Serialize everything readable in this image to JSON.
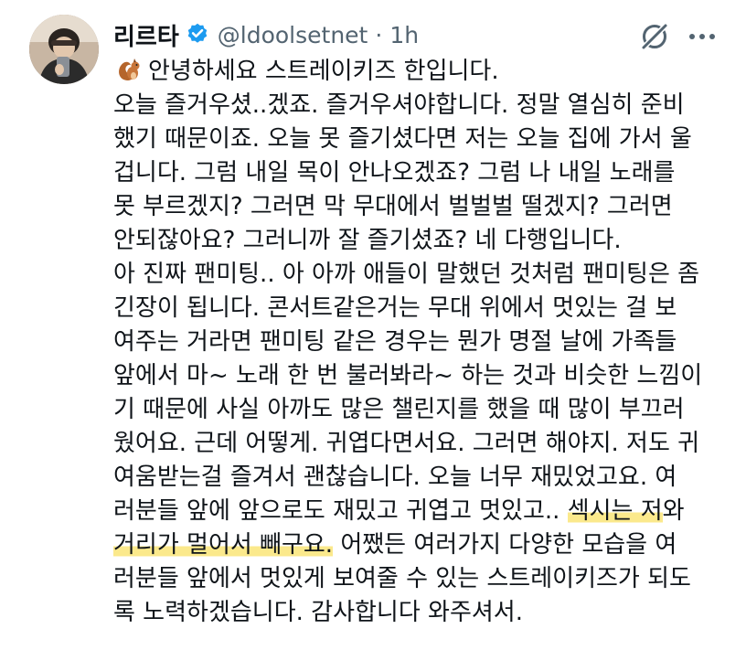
{
  "author": {
    "display_name": "리르타",
    "handle": "@ldoolsetnet",
    "separator": "·",
    "timestamp": "1h"
  },
  "icons": {
    "verified": "verified-badge-icon",
    "grok": "grok-icon",
    "more": "more-options-icon",
    "squirrel": "squirrel-emoji"
  },
  "colors": {
    "verified": "#1d9bf0",
    "highlight": "#fbe98c",
    "secondary_text": "#536471"
  },
  "tweet": {
    "lines": [
      [
        {
          "t": "안녕하세요 스트레이키즈 한입니다."
        }
      ],
      [
        {
          "t": "오늘 즐거우셨..겠죠. 즐거우셔야합니다. 정말 열심히 준비"
        }
      ],
      [
        {
          "t": "했기 때문이죠. 오늘 못 즐기셨다면 저는 오늘 집에 가서 울"
        }
      ],
      [
        {
          "t": "겁니다. 그럼 내일 목이 안나오겠죠? 그럼 나 내일 노래를"
        }
      ],
      [
        {
          "t": "못 부르겠지? 그러면 막 무대에서 벌벌벌 떨겠지? 그러면"
        }
      ],
      [
        {
          "t": "안되잖아요? 그러니까 잘 즐기셨죠? 네 다행입니다."
        }
      ],
      [
        {
          "t": "아 진짜 팬미팅.. 아 아까 애들이 말했던 것처럼 팬미팅은 좀"
        }
      ],
      [
        {
          "t": "긴장이 됩니다. 콘서트같은거는 무대 위에서 멋있는 걸 보"
        }
      ],
      [
        {
          "t": "여주는 거라면 팬미팅 같은 경우는 뭔가 명절 날에 가족들"
        }
      ],
      [
        {
          "t": "앞에서 마~ 노래 한 번 불러봐라~ 하는 것과 비슷한 느낌이"
        }
      ],
      [
        {
          "t": "기 때문에 사실 아까도 많은 챌린지를 했을 때 많이 부끄러"
        }
      ],
      [
        {
          "t": "웠어요. 근데 어떻게. 귀엽다면서요. 그러면 해야지. 저도 귀"
        }
      ],
      [
        {
          "t": "여움받는걸 즐겨서 괜찮습니다. 오늘 너무 재밌었고요. 여"
        }
      ],
      [
        {
          "t": "러분들 앞에 앞으로도 재밌고 귀엽고 멋있고.. "
        },
        {
          "t": "섹시는 저",
          "hl": true
        },
        {
          "t": "와"
        }
      ],
      [
        {
          "t": "거리가 멀어서 빼구요.",
          "hl": true
        },
        {
          "t": " 어쨌든 여러가지 다양한 모습을 여"
        }
      ],
      [
        {
          "t": "러분들 앞에서 멋있게 보여줄 수 있는 스트레이키즈가 되도"
        }
      ],
      [
        {
          "t": "록 노력하겠습니다. 감사합니다 와주셔서."
        }
      ]
    ]
  }
}
